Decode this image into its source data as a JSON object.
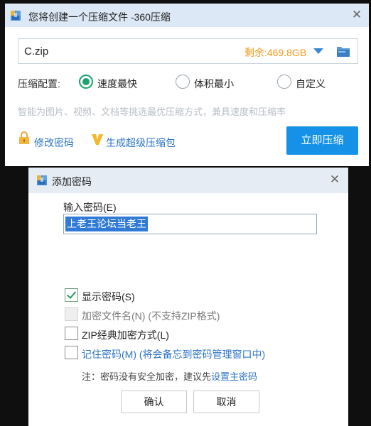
{
  "main_window": {
    "title": "您将创建一个压缩文件 -360压缩",
    "file_name": "C.zip",
    "remaining": "剩余:469.8GB",
    "config_label": "压缩配置:",
    "options": [
      {
        "label": "速度最快",
        "selected": true
      },
      {
        "label": "体积最小",
        "selected": false
      },
      {
        "label": "自定义",
        "selected": false
      }
    ],
    "hint": "智能为图片、视频、文档等挑选最优压缩方式，兼具速度和压缩率",
    "change_password": "修改密码",
    "super_package": "生成超级压缩包",
    "compress_now": "立即压缩"
  },
  "password_dialog": {
    "title": "添加密码",
    "input_label": "输入密码(E)",
    "input_value": "上老王论坛当老王",
    "checkboxes": [
      {
        "label": "显示密码(S)",
        "checked": true,
        "disabled": false
      },
      {
        "label": "加密文件名(N) (不支持ZIP格式)",
        "checked": false,
        "disabled": true
      },
      {
        "label": "ZIP经典加密方式(L)",
        "checked": false,
        "disabled": false
      },
      {
        "label": "记住密码(M) (将会备忘到密码管理窗口中)",
        "checked": false,
        "disabled": false
      }
    ],
    "note_prefix": "注：密码没有安全加密，建议先",
    "note_link": "设置主密码",
    "ok": "确认",
    "cancel": "取消"
  },
  "colors": {
    "accent_blue": "#1592e8",
    "link_blue": "#2b74c7",
    "remaining_orange": "#f09a1a",
    "radio_green": "#1da36f",
    "selection_blue": "#2f7ad6"
  },
  "icons": [
    "app-icon",
    "close-icon",
    "dropdown-arrow-icon",
    "folder-icon",
    "lock-icon",
    "v-icon",
    "checkmark-icon"
  ]
}
